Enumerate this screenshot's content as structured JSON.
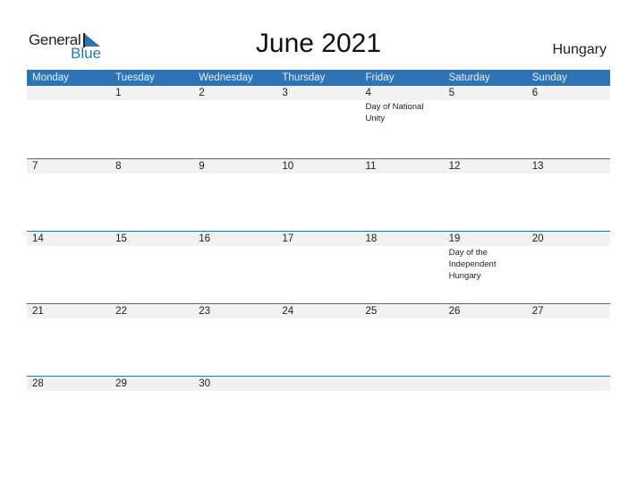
{
  "logo": {
    "general": "General",
    "blue": "Blue"
  },
  "title": "June 2021",
  "country": "Hungary",
  "weekdays": [
    "Monday",
    "Tuesday",
    "Wednesday",
    "Thursday",
    "Friday",
    "Saturday",
    "Sunday"
  ],
  "weeks": [
    {
      "days": [
        "",
        "1",
        "2",
        "3",
        "4",
        "5",
        "6"
      ],
      "events": [
        "",
        "",
        "",
        "",
        "Day of National Unity",
        "",
        ""
      ]
    },
    {
      "days": [
        "7",
        "8",
        "9",
        "10",
        "11",
        "12",
        "13"
      ],
      "events": [
        "",
        "",
        "",
        "",
        "",
        "",
        ""
      ]
    },
    {
      "days": [
        "14",
        "15",
        "16",
        "17",
        "18",
        "19",
        "20"
      ],
      "events": [
        "",
        "",
        "",
        "",
        "",
        "Day of the Independent Hungary",
        ""
      ]
    },
    {
      "days": [
        "21",
        "22",
        "23",
        "24",
        "25",
        "26",
        "27"
      ],
      "events": [
        "",
        "",
        "",
        "",
        "",
        "",
        ""
      ]
    },
    {
      "days": [
        "28",
        "29",
        "30",
        "",
        "",
        "",
        ""
      ],
      "events": [
        "",
        "",
        "",
        "",
        "",
        "",
        ""
      ]
    }
  ],
  "colors": {
    "accent": "#2e74b5",
    "date_strip": "#f2f2f2"
  }
}
